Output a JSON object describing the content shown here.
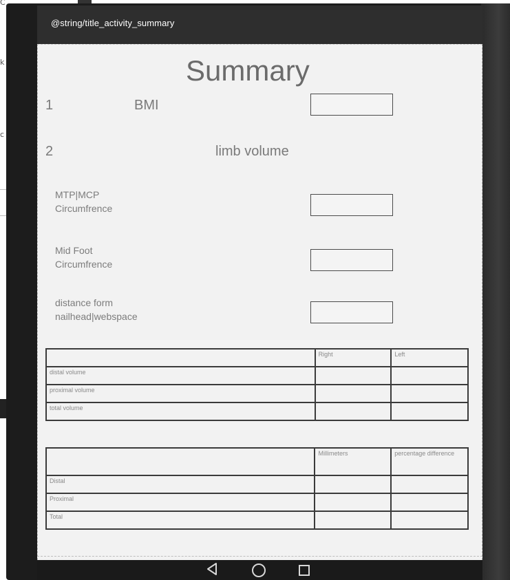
{
  "window": {
    "action_bar_title": "@string/title_activity_summary"
  },
  "summary": {
    "title": "Summary",
    "section1": {
      "number": "1",
      "label": "BMI",
      "value": ""
    },
    "section2": {
      "number": "2",
      "label": "limb volume"
    },
    "fields": [
      {
        "label_line1": "MTP|MCP",
        "label_line2": "Circumfrence",
        "value": ""
      },
      {
        "label_line1": "Mid Foot",
        "label_line2": "Circumfrence",
        "value": ""
      },
      {
        "label_line1": "distance form",
        "label_line2": "nailhead|webspace",
        "value": ""
      }
    ]
  },
  "volume_table": {
    "headers": [
      "",
      "Right",
      "Left"
    ],
    "rows": [
      {
        "label": "distal volume",
        "right": "",
        "left": ""
      },
      {
        "label": "proximal volume",
        "right": "",
        "left": ""
      },
      {
        "label": "total volume",
        "right": "",
        "left": ""
      }
    ]
  },
  "difference_table": {
    "headers": [
      "",
      "Millimeters",
      "percentage difference"
    ],
    "rows": [
      {
        "label": "Distal",
        "mm": "",
        "pct": ""
      },
      {
        "label": "Proximal",
        "mm": "",
        "pct": ""
      },
      {
        "label": "Total",
        "mm": "",
        "pct": ""
      }
    ]
  },
  "background_scraps": [
    "C",
    "k",
    "c"
  ],
  "navbar": {
    "icons": [
      "back-icon",
      "home-icon",
      "recents-icon"
    ]
  },
  "colors": {
    "screen_bg": "#f2f2f2",
    "action_bar": "#2e2e2e",
    "device": "#1c1c1c"
  }
}
